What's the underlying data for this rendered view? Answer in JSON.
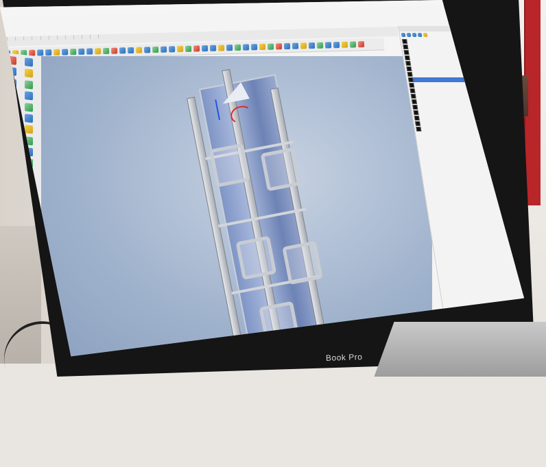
{
  "brand": {
    "text": "Book Pro"
  },
  "menu": {
    "items": [
      "",
      "",
      "",
      "",
      "",
      "",
      "",
      "",
      "",
      "",
      "",
      ""
    ]
  },
  "layers": {
    "rows": [
      {
        "selected": false
      },
      {
        "selected": false
      },
      {
        "selected": false
      },
      {
        "selected": false
      },
      {
        "selected": false
      },
      {
        "selected": false
      },
      {
        "selected": false
      },
      {
        "selected": true
      },
      {
        "selected": false
      },
      {
        "selected": false
      },
      {
        "selected": false
      },
      {
        "selected": false
      },
      {
        "selected": false
      },
      {
        "selected": false
      },
      {
        "selected": false
      },
      {
        "selected": false
      },
      {
        "selected": false
      }
    ]
  },
  "colors": {
    "viewport": "#9fb2cc",
    "model": "#7f95c6",
    "ground": "#3b5ea3",
    "selection": "#3f78d6",
    "gumball_red": "#e02a2a",
    "gumball_blue": "#2255dd"
  }
}
